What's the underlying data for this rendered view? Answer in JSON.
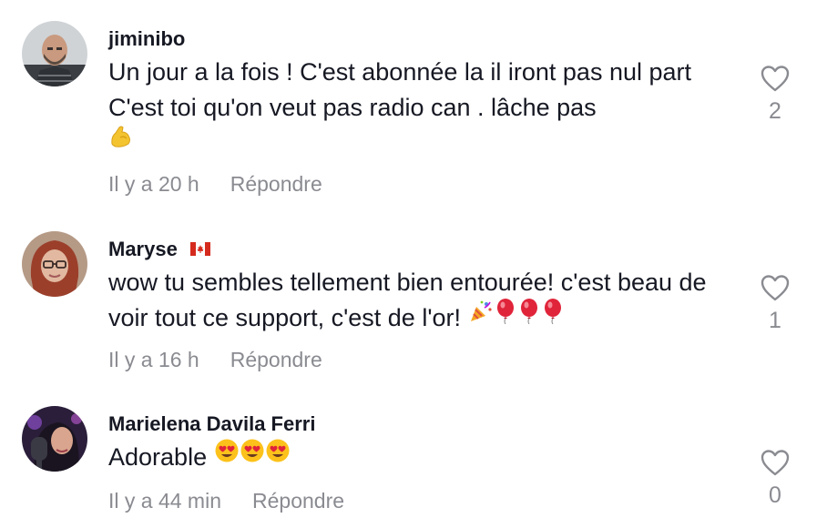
{
  "comments": [
    {
      "username": "jiminibo",
      "text": "Un jour a la fois ! C'est abonnée la il iront pas nul part C'est toi qu'on veut pas radio can . lâche pas",
      "emojis": [
        "flexed-biceps"
      ],
      "time": "Il y a 20 h",
      "reply_label": "Répondre",
      "likes": "2"
    },
    {
      "username": "Maryse",
      "flag": "canada-flag",
      "text": "wow tu sembles tellement bien entourée! c'est beau de voir tout ce support, c'est de l'or!",
      "emojis": [
        "party-popper",
        "balloon",
        "balloon",
        "balloon"
      ],
      "time": "Il y a 16 h",
      "reply_label": "Répondre",
      "likes": "1"
    },
    {
      "username": "Marielena Davila Ferri",
      "text": "Adorable",
      "emojis": [
        "heart-eyes",
        "heart-eyes",
        "heart-eyes"
      ],
      "time": "Il y a 44 min",
      "reply_label": "Répondre",
      "likes": "0"
    }
  ],
  "colors": {
    "text": "#161823",
    "secondary": "#8a8b91"
  }
}
